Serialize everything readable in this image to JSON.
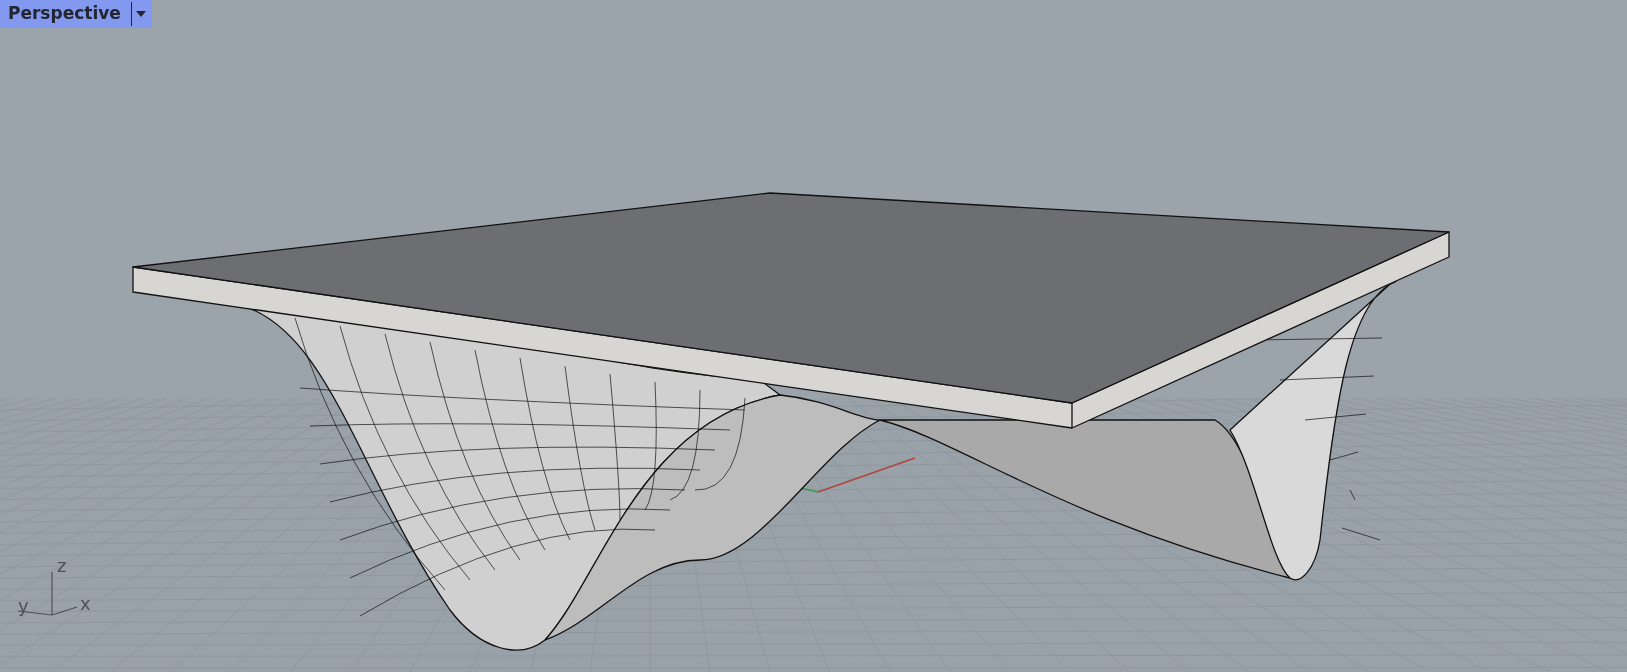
{
  "viewport": {
    "title": "Perspective",
    "active": true
  },
  "axis_widget": {
    "labels": [
      "z",
      "y",
      "x"
    ]
  }
}
